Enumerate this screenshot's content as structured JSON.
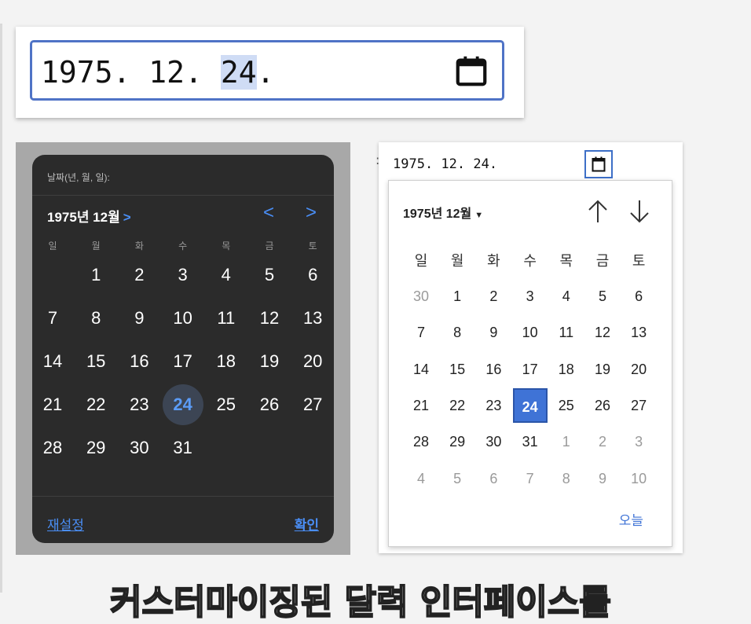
{
  "big_input": {
    "year": "1975",
    "month": "12",
    "day": "24",
    "sep": ". "
  },
  "dark_picker": {
    "label": "날짜(년, 월, 일):",
    "month_title": "1975년 12월",
    "chevron": ">",
    "prev": "<",
    "next": ">",
    "weekdays": [
      "일",
      "월",
      "화",
      "수",
      "목",
      "금",
      "토"
    ],
    "weeks": [
      [
        "",
        "1",
        "2",
        "3",
        "4",
        "5",
        "6"
      ],
      [
        "7",
        "8",
        "9",
        "10",
        "11",
        "12",
        "13"
      ],
      [
        "14",
        "15",
        "16",
        "17",
        "18",
        "19",
        "20"
      ],
      [
        "21",
        "22",
        "23",
        "24",
        "25",
        "26",
        "27"
      ],
      [
        "28",
        "29",
        "30",
        "31",
        "",
        "",
        ""
      ]
    ],
    "selected": "24",
    "reset": "재설정",
    "confirm": "확인"
  },
  "chrome_picker": {
    "input_text": "1975. 12. 24.",
    "month_title": "1975년 12월",
    "caret": "▼",
    "weekdays": [
      "일",
      "월",
      "화",
      "수",
      "목",
      "금",
      "토"
    ],
    "weeks": [
      [
        "30",
        "1",
        "2",
        "3",
        "4",
        "5",
        "6"
      ],
      [
        "7",
        "8",
        "9",
        "10",
        "11",
        "12",
        "13"
      ],
      [
        "14",
        "15",
        "16",
        "17",
        "18",
        "19",
        "20"
      ],
      [
        "21",
        "22",
        "23",
        "24",
        "25",
        "26",
        "27"
      ],
      [
        "28",
        "29",
        "30",
        "31",
        "1",
        "2",
        "3"
      ],
      [
        "4",
        "5",
        "6",
        "7",
        "8",
        "9",
        "10"
      ]
    ],
    "out_of_month": [
      [
        0,
        0
      ],
      [
        4,
        4
      ],
      [
        4,
        5
      ],
      [
        4,
        6
      ],
      [
        5,
        0
      ],
      [
        5,
        1
      ],
      [
        5,
        2
      ],
      [
        5,
        3
      ],
      [
        5,
        4
      ],
      [
        5,
        5
      ],
      [
        5,
        6
      ]
    ],
    "selected": "24",
    "today": "오늘"
  },
  "colors": {
    "accent_dark": "#4a8ef5",
    "accent_chrome": "#3f73d6",
    "dark_bg": "#2b2b2b"
  },
  "subtitle": "커스터마이징된 달력 인터페이스를"
}
